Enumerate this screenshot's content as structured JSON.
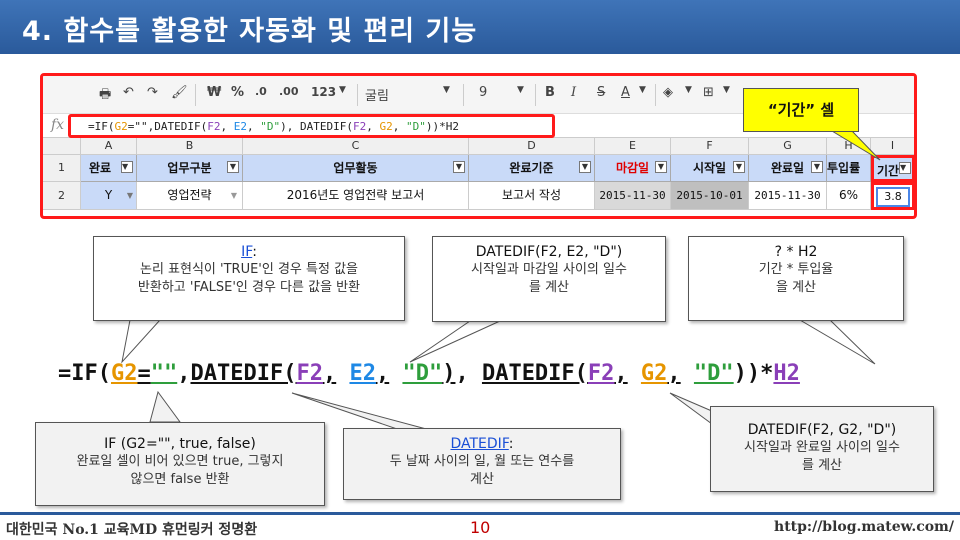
{
  "title": "4. 함수를 활용한 자동화 및 편리 기능",
  "toolbar": {
    "currency": "₩",
    "percent": "%",
    "decimal_less": ".0",
    "decimal_more": ".00",
    "number_format": "123",
    "font": "굴림",
    "font_size": "9",
    "bold": "B",
    "italic": "I",
    "strike": "S",
    "text_color": "A"
  },
  "formula_bar": {
    "fx": "fx",
    "formula_parts": [
      "=IF(",
      "G2",
      "=\"\",DATEDIF(",
      "F2",
      ", ",
      "E2",
      ", ",
      "\"D\"",
      "), DATEDIF(",
      "F2",
      ", ",
      "G2",
      ", ",
      "\"D\"",
      "))*H2"
    ]
  },
  "columns": [
    "A",
    "B",
    "C",
    "D",
    "E",
    "F",
    "G",
    "H",
    "I"
  ],
  "rows": [
    "1",
    "2"
  ],
  "headers": [
    "완료",
    "업무구분",
    "업무활동",
    "완료기준",
    "마감일",
    "시작일",
    "완료일",
    "투입률",
    "기간"
  ],
  "row2": [
    "Y",
    "영업전략",
    "2016년도 영업전략 보고서",
    "보고서 작성",
    "2015-11-30",
    "2015-10-01",
    "2015-11-30",
    "6%",
    "3.8"
  ],
  "callout_period": "“기간” 셀",
  "callouts": {
    "if_top": {
      "head": "IF",
      "suffix": ":",
      "body1": "논리 표현식이 'TRUE'인 경우 특정 값을",
      "body2": "반환하고 'FALSE'인 경우 다른 값을 반환"
    },
    "datedif_fe": {
      "head": "DATEDIF(F2, E2, \"D\")",
      "body1": "시작일과 마감일 사이의 일수",
      "body2": "를 계산"
    },
    "h2": {
      "head": "? * H2",
      "body1": "기간 * 투입율",
      "body2": "을 계산"
    },
    "if_bottom": {
      "head": "IF (G2=\"\", true, false)",
      "body1": "완료일 셀이 비어 있으면 true, 그렇지",
      "body2": "않으면 false 반환"
    },
    "datedif_def": {
      "head": "DATEDIF",
      "suffix": ":",
      "body1": "두 날짜 사이의 일, 월 또는 연수를",
      "body2": "계산"
    },
    "datedif_fg": {
      "head": "DATEDIF(F2, G2, \"D\")",
      "body1": "시작일과 완료일 사이의 일수",
      "body2": "를 계산"
    }
  },
  "big_formula": {
    "p1": "=IF(",
    "g2": "G2",
    "eq": "=",
    "empty": "\"\"",
    "comma1": ",",
    "datedif1": "DATEDIF(",
    "f2a": "F2",
    "c2": ",",
    "e2": "E2",
    "c3": ",",
    "d1": "\"D\"",
    "close1": ")",
    "c4": ",",
    "datedif2": "DATEDIF(",
    "f2b": "F2",
    "c5": ",",
    "g2b": "G2",
    "c6": ",",
    "d2": "\"D\"",
    "close2": "))*",
    "h2": "H2"
  },
  "footer": {
    "left": "대한민국 No.1 교육MD 휴먼링커 정명환",
    "page": "10",
    "right": "http://blog.matew.com/"
  }
}
